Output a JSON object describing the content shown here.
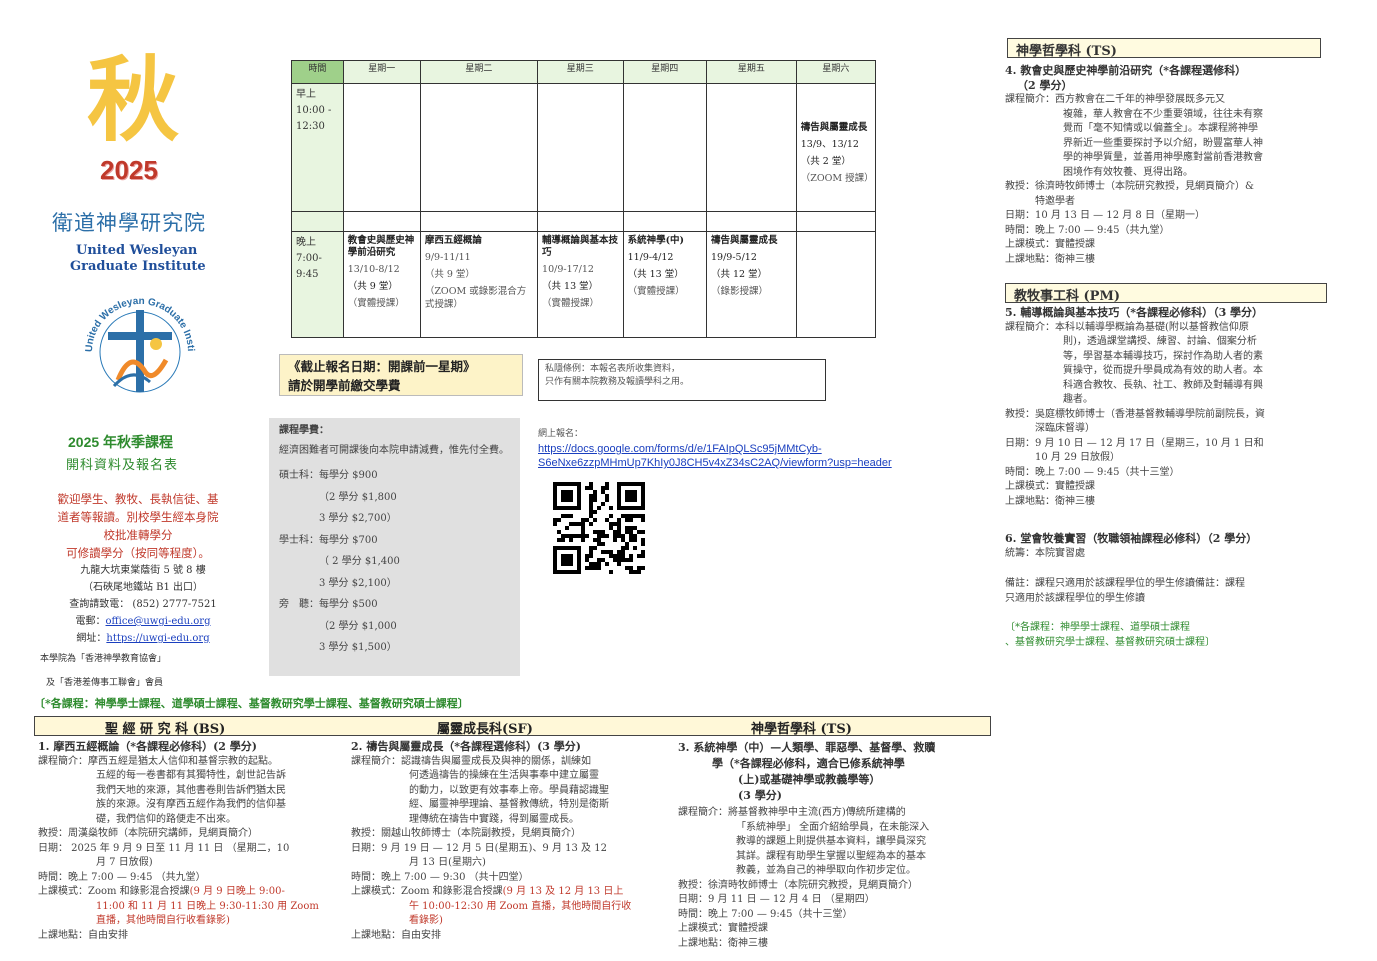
{
  "left": {
    "autumn_char": "秋",
    "year": "2025",
    "school_cn": "衛道神學研究院",
    "school_en_1": "United Wesleyan",
    "school_en_2": "Graduate Institute",
    "seal_text": "United Wesleyan Graduate Institute 衛道神學研究院",
    "term_title": "2025 年秋季課程",
    "term_sub": "開科資料及報名表",
    "welcome_1": "歡迎學生、教牧、長執信徒、基",
    "welcome_2": "道者等報讀。別校學生經本身院",
    "welcome_3": "校批准轉學分",
    "welcome_4": "可修讀學分（按同等程度）。",
    "address_1": "九龍大坑東棠蔭街 5 號 8 樓",
    "address_2": "（石硤尾地鐵站 B1 出口）",
    "phone": "查詢請致電： (852) 2777-7521",
    "email_label": "電郵：",
    "email": "office@uwgi-edu.org",
    "web_label": "網址：",
    "web": "https://uwgi-edu.org",
    "member_1": "本學院為「香港神學教育協會」",
    "member_2": "及「香港差傳事工聯會」會員"
  },
  "timetable": {
    "headers": [
      "時間",
      "星期一",
      "星期二",
      "星期三",
      "星期四",
      "星期五",
      "星期六"
    ],
    "am_time": [
      "早上",
      "10:00 -",
      "12:30"
    ],
    "sat_am": {
      "title": "禱告與屬靈成長",
      "date": "13/9、13/12",
      "count": "（共 2 堂）",
      "mode": "（ZOOM 授課）"
    },
    "pm_time": [
      "晚上",
      "7:00-",
      "9:45"
    ],
    "pm": [
      {
        "title": "教會史與歷史神學前沿研究",
        "date": "13/10-8/12",
        "count": "（共 9 堂）",
        "mode": "（實體授課）"
      },
      {
        "title": "摩西五經概論",
        "date": "9/9-11/11",
        "count": "（共 9 堂）",
        "mode": "（ZOOM 或錄影混合方式授課）"
      },
      {
        "title": "輔導概論與基本技巧",
        "date": "10/9-17/12",
        "count": "（共 13 堂）",
        "mode": "（實體授課）"
      },
      {
        "title": "系統神學(中)",
        "date": "11/9-4/12",
        "count": "（共 13 堂）",
        "mode": "（實體授課）"
      },
      {
        "title": "禱告與屬靈成長",
        "date": "19/9-5/12",
        "count": "（共 12 堂）",
        "mode": "（錄影授課）"
      }
    ]
  },
  "deadline_1": "《截止報名日期：開課前一星期》",
  "deadline_2": "請於開學前繳交學費",
  "privacy_1": "私隱條例：本報名表所收集資料，",
  "privacy_2": "只作有關本院教務及報讀學科之用。",
  "fees": {
    "title": "課程學費：",
    "note": "經濟困難者可開課後向本院申請減費，惟先付全費。",
    "lines": [
      "碩士科：每學分 $900",
      "（2 學分 $1,800",
      "3 學分 $2,700）",
      "學士科：每學分 $700",
      "（ 2 學分 $1,400",
      "3 學分 $2,100）",
      "旁　聽：每學分 $500",
      "（2 學分 $1,000",
      "3 學分 $1,500）"
    ]
  },
  "online": {
    "label": "網上報名：",
    "url_1": "https://docs.google.com/forms/d/e/1FAIpQLSc95jMMtCyb-",
    "url_2": "S6eNxe6zzpMHmUp7KhIy0J8CH5v4xZ34sC2AQ/viewform?usp=header"
  },
  "course_types": "〔*各課程：神學學士課程、道學碩士課程、基督教研究學士課程、基督教研究碩士課程〕",
  "bottom_heads": [
    "聖 經 研 究 科 (BS)",
    "屬靈成長科(SF)",
    "神學哲學科 (TS)"
  ],
  "bs": {
    "title": "1. 摩西五經概論（*各課程必修科）(2 學分)",
    "intro_label": "課程簡介：",
    "intro": [
      "摩西五經是猶太人信仰和基督宗教的起點。",
      "五經的每一卷書都有其獨特性，創世記告訴",
      "我們天地的來源，其他書卷則告訴們猶太民",
      "族的來源。沒有摩西五經作為我們的信仰基",
      "礎，我們信仰的路便走不出來。"
    ],
    "teacher": "教授：周漢燊牧師（本院研究講師，見網頁簡介）",
    "date_1": "日期： 2025 年 9 月 9 日至 11 月 11 日 （星期二，10",
    "date_2": "月 7 日放假)",
    "time": "時間：晚上 7:00 — 9:45 （共九堂）",
    "mode_label": "上課模式：Zoom 和錄影混合授課",
    "mode_red_1": "(9 月 9 日晚上 9:00-",
    "mode_red_2": "11:00 和 11 月 11 日晚上 9:30-11:30 用 Zoom",
    "mode_red_3": "直播，其他時間自行收看錄影)",
    "place": "上課地點：自由安排"
  },
  "sf": {
    "title": "2. 禱告與屬靈成長（*各課程選修科）(3 學分)",
    "intro_label": "課程簡介：",
    "intro": [
      "認識禱告與屬靈成長及與神的關係，訓練如",
      "何透過禱告的操練在生活與事奉中建立屬靈",
      "的動力，以致更有效事奉上帝。學員藉認識聖",
      "經、屬靈神學理論、基督教傳統，特別是衛斯",
      "理傳統在禱告中實踐，得到屬靈成長。"
    ],
    "teacher": "教授：關越山牧師博士（本院副教授，見網頁簡介）",
    "date_1": "日期：9 月 19 日 — 12 月 5 日(星期五)、9 月 13 及 12",
    "date_2": "月 13 日(星期六)",
    "time": "時間：晚上 7:00 — 9:30 （共十四堂）",
    "mode_label": "上課模式：Zoom 和錄影混合授課",
    "mode_red_1": "(9 月 13 及 12 月 13 日上",
    "mode_red_2": "午 10:00-12:30 用 Zoom 直播，其他時間自行收",
    "mode_red_3": "看錄影)",
    "place": "上課地點：自由安排"
  },
  "ts3": {
    "title_1": "3. 系統神學（中）—人類學、罪惡學、基督學、救贖",
    "title_2": "學（*各課程必修科，適合已修系統神學",
    "title_3": "(上)或基礎神學或教義學等）",
    "title_4": "(3 學分)",
    "intro_label": "課程簡介：",
    "intro": [
      "將基督教神學中主流(西方)傳統所建構的",
      "「系統神學」 全面介紹給學員，在未能深入",
      "教導的課題上則提供基本資料，讓學員深究",
      "其詳。課程有助學生掌握以聖經為本的基本",
      "教義，並為自己的神學取向作初步定位。"
    ],
    "teacher": "教授：徐濟時牧師博士（本院研究教授，見網頁簡介）",
    "date": "日期：9 月 11 日 — 12 月 4 日 （星期四）",
    "time": "時間：晚上 7:00 — 9:45（共十三堂）",
    "mode": "上課模式：實體授課",
    "place": "上課地點：衛神三樓"
  },
  "right": {
    "ts_head": "神學哲學科 (TS)",
    "c4_title": "4. 教會史與歷史神學前沿研究（*各課程選修科）",
    "c4_credit": "（2 學分）",
    "c4_intro_label": "課程簡介：",
    "c4_intro": [
      "西方教會在二千年的神學發展既多元又",
      "複雜，華人教會在不少重要領域，往往未有察",
      "覺而「毫不知情或以偏蓋全」。本課程將神學",
      "界新近一些重要探討予以介紹，盼豐富華人神",
      "學的神學質量，並善用神學應對當前香港教會",
      "困境作有效牧養、覓得出路。"
    ],
    "c4_teacher_1": "教授：徐濟時牧師博士（本院研究教授，見網頁簡介）&",
    "c4_teacher_2": "特邀學者",
    "c4_date": "日期：10 月 13 日 — 12 月 8 日（星期一）",
    "c4_time": "時間：晚上 7:00 — 9:45（共九堂）",
    "c4_mode": "上課模式：實體授課",
    "c4_place": "上課地點：衛神三樓",
    "pm_head": "教牧事工科 (PM)",
    "c5_title": "5. 輔導概論與基本技巧（*各課程必修科）（3 學分）",
    "c5_intro_label": "課程簡介：",
    "c5_intro": [
      "本科以輔導學概論為基礎(附以基督教信仰原",
      "則)，透過課堂講授、練習、討論、個案分析",
      "等，學習基本輔導技巧，探討作為助人者的素",
      "質操守，從而提升學員成為有效的助人者。本",
      "科適合教牧、長執、社工、教師及對輔導有興",
      "趣者。"
    ],
    "c5_teacher_1": "教授：吳庭標牧師博士（香港基督教輔導學院前副院長，資",
    "c5_teacher_2": "深臨床督導）",
    "c5_date_1": "日期：9 月 10 日 — 12 月 17 日（星期三，10 月 1 日和",
    "c5_date_2": "10 月 29 日放假）",
    "c5_time": "時間：晚上 7:00 — 9:45（共十三堂）",
    "c5_mode": "上課模式：實體授課",
    "c5_place": "上課地點：衛神三樓",
    "c6_title": "6. 堂會牧養實習（牧職領袖課程必修科）（2 學分）",
    "c6_coord": "統籌：本院實習處",
    "remark_1": "備註：課程只適用於該課程學位的學生修讀備註：課程",
    "remark_2": "只適用於該課程學位的學生修讀",
    "types_1": "〔*各課程：神學學士課程、道學碩士課程",
    "types_2": "、基督教研究學士課程、基督教研究碩士課程〕"
  }
}
